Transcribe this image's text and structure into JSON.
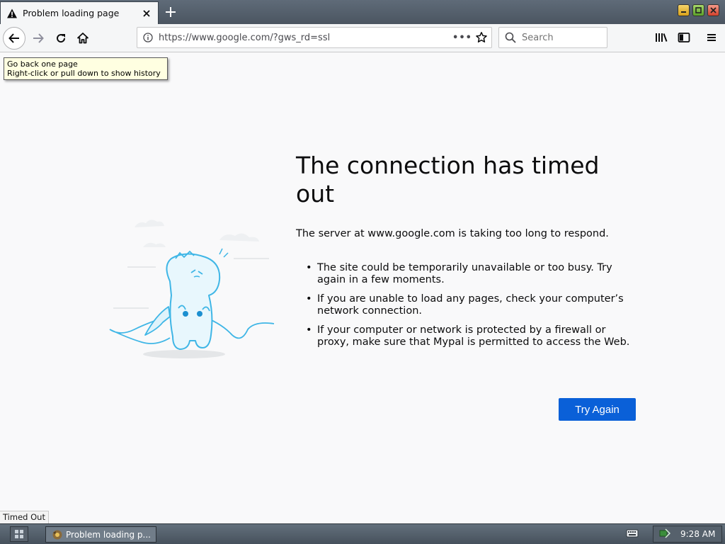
{
  "tab": {
    "title": "Problem loading page"
  },
  "navbar": {
    "url": "https://www.google.com/?gws_rd=ssl",
    "page_action_label": "•••",
    "search_placeholder": "Search"
  },
  "tooltip": {
    "line1": "Go back one page",
    "line2": "Right-click or pull down to show history"
  },
  "error": {
    "title": "The connection has timed out",
    "short_desc": "The server at www.google.com is taking too long to respond.",
    "bullets": [
      "The site could be temporarily unavailable or too busy. Try again in a few moments.",
      "If you are unable to load any pages, check your computer’s network connection.",
      "If your computer or network is protected by a firewall or proxy, make sure that Mypal is permitted to access the Web."
    ],
    "try_again_label": "Try Again"
  },
  "status": {
    "text": "Timed Out"
  },
  "taskbar": {
    "task_label": "Problem loading p...",
    "clock": "9:28 AM"
  },
  "colors": {
    "accent": "#0a60d8",
    "tooltip_bg": "#ffffe1",
    "page_bg": "#f9f9fa"
  }
}
